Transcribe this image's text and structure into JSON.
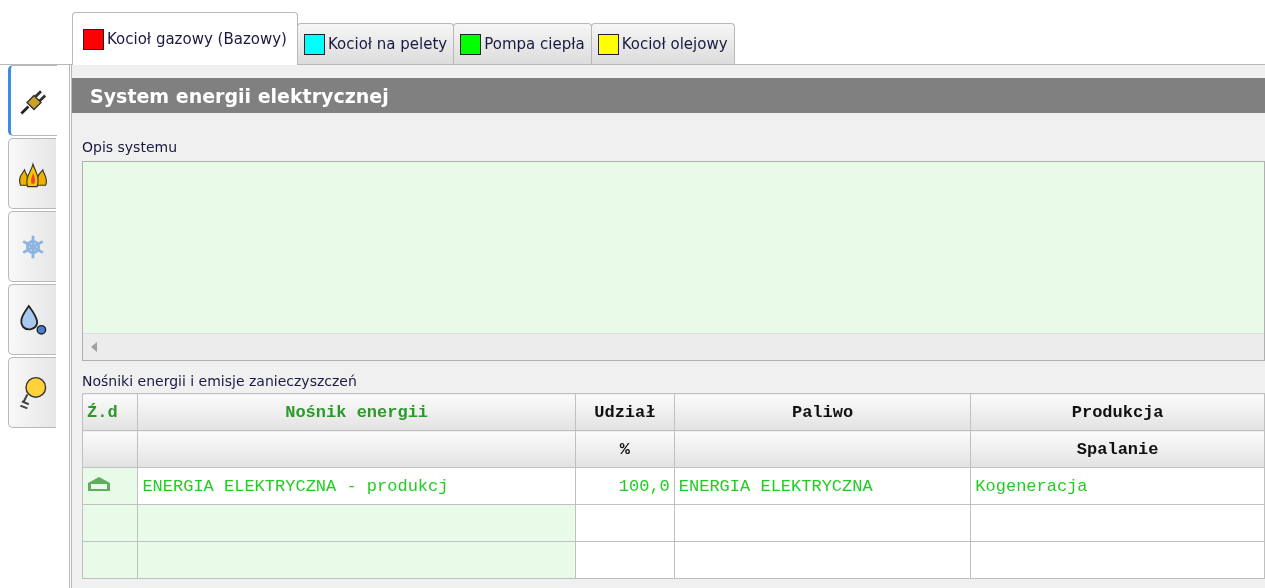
{
  "tabs": [
    {
      "label": "Kocioł gazowy (Bazowy)",
      "color": "#ff0000",
      "selected": true
    },
    {
      "label": "Kocioł na pelety",
      "color": "#00ffff",
      "selected": false
    },
    {
      "label": "Pompa ciepła",
      "color": "#00ff00",
      "selected": false
    },
    {
      "label": "Kocioł olejowy",
      "color": "#ffff00",
      "selected": false
    }
  ],
  "side_tabs": [
    {
      "kind": "plug",
      "selected": true
    },
    {
      "kind": "flame",
      "selected": false
    },
    {
      "kind": "snowflake",
      "selected": false
    },
    {
      "kind": "drops",
      "selected": false
    },
    {
      "kind": "bulb",
      "selected": false
    }
  ],
  "panel": {
    "title": "System energii elektrycznej",
    "description_label": "Opis systemu",
    "carriers_label": "Nośniki energii i emisje zanieczyszczeń"
  },
  "table": {
    "columns": [
      {
        "header": "Ź.d",
        "highlighted": true
      },
      {
        "header": "Nośnik energii",
        "highlighted": true
      },
      {
        "header": "Udział",
        "subheader": "%",
        "highlighted": false
      },
      {
        "header": "Paliwo",
        "highlighted": false
      },
      {
        "header": "Produkcja",
        "subheader": "Spalanie",
        "highlighted": false
      }
    ],
    "rows": [
      {
        "cells": [
          {
            "kind": "icon"
          },
          {
            "kind": "text",
            "text": "ENERGIA ELEKTRYCZNA - produkcj"
          },
          {
            "kind": "number",
            "text": "100,0"
          },
          {
            "kind": "text",
            "text": "ENERGIA ELEKTRYCZNA"
          },
          {
            "kind": "text",
            "text": "Kogeneracja"
          }
        ]
      },
      {
        "cells": []
      },
      {
        "cells": []
      }
    ]
  }
}
